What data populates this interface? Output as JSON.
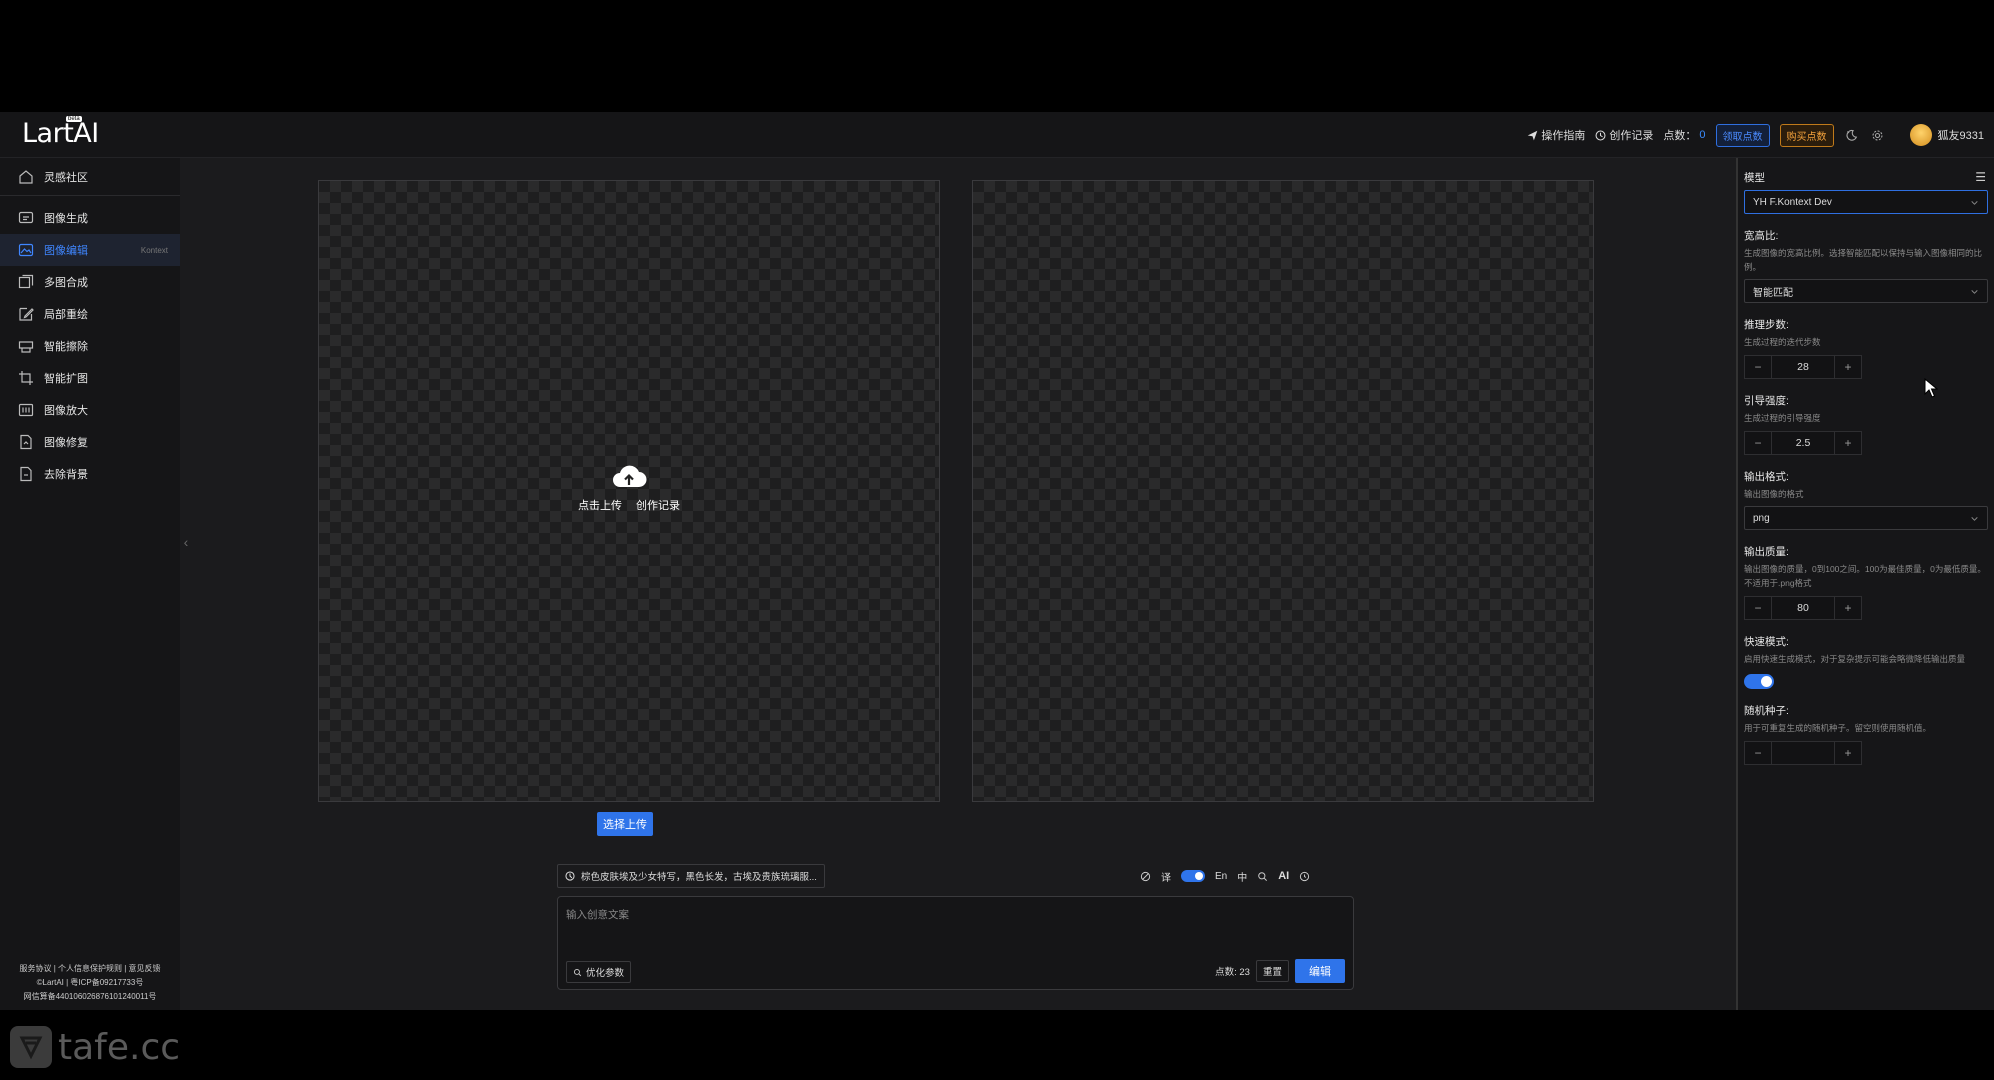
{
  "header": {
    "logo_text": "LartAI",
    "logo_badge": "beta",
    "guide": "操作指南",
    "history": "创作记录",
    "points_label": "点数：",
    "points_value": "0",
    "get_points": "领取点数",
    "buy_points": "购买点数",
    "username": "狐友9331"
  },
  "sidebar": {
    "community": "灵感社区",
    "items": [
      {
        "label": "图像生成",
        "icon": "chat-image-icon"
      },
      {
        "label": "图像编辑",
        "icon": "image-edit-icon",
        "tag": "Kontext",
        "active": true
      },
      {
        "label": "多图合成",
        "icon": "multi-image-icon"
      },
      {
        "label": "局部重绘",
        "icon": "pencil-icon"
      },
      {
        "label": "智能擦除",
        "icon": "eraser-icon"
      },
      {
        "label": "智能扩图",
        "icon": "crop-icon"
      },
      {
        "label": "图像放大",
        "icon": "upscale-icon"
      },
      {
        "label": "图像修复",
        "icon": "repair-icon"
      },
      {
        "label": "去除背景",
        "icon": "remove-bg-icon"
      }
    ],
    "footer_line1": "服务协议 | 个人信息保护规则 | 意见反馈",
    "footer_line2": "©LartAI | 粤ICP备09217733号",
    "footer_line3": "网信算备440106026876101240011号"
  },
  "canvas": {
    "upload_click": "点击上传",
    "upload_history": "创作记录",
    "select_upload": "选择上传"
  },
  "prompt": {
    "suggestion": "棕色皮肤埃及少女特写，黑色长发，古埃及贵族琉璃服...",
    "translate_label": "译",
    "lang_en": "En",
    "lang_zh": "中",
    "ai_label": "AI",
    "placeholder": "输入创意文案",
    "optimize": "优化参数",
    "points_cost": "点数: 23",
    "reset": "重置",
    "edit": "编辑"
  },
  "panel": {
    "model_label": "模型",
    "model_value": "YH F.Kontext Dev",
    "aspect_label": "宽高比:",
    "aspect_desc": "生成图像的宽高比例。选择智能匹配以保持与输入图像相同的比例。",
    "aspect_value": "智能匹配",
    "steps_label": "推理步数:",
    "steps_desc": "生成过程的迭代步数",
    "steps_value": "28",
    "guidance_label": "引导强度:",
    "guidance_desc": "生成过程的引导强度",
    "guidance_value": "2.5",
    "format_label": "输出格式:",
    "format_desc": "输出图像的格式",
    "format_value": "png",
    "quality_label": "输出质量:",
    "quality_desc": "输出图像的质量，0到100之间。100为最佳质量，0为最低质量。不适用于.png格式",
    "quality_value": "80",
    "fast_label": "快速模式:",
    "fast_desc": "启用快速生成模式，对于复杂提示可能会略微降低输出质量",
    "seed_label": "随机种子:",
    "seed_desc": "用于可重复生成的随机种子。留空则使用随机值。",
    "seed_value": ""
  },
  "watermark": "tafe.cc"
}
